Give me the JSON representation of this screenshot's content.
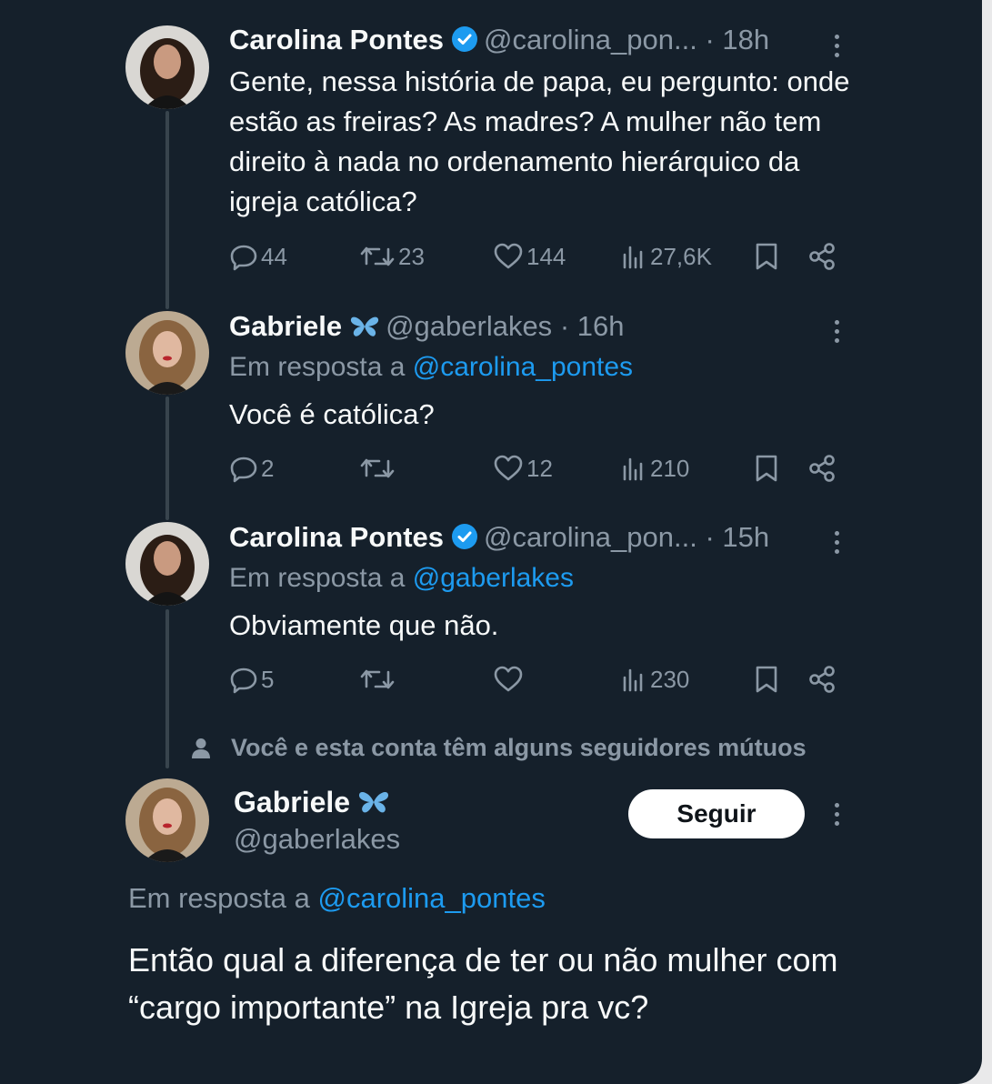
{
  "thread": [
    {
      "name": "Carolina Pontes",
      "verified": true,
      "handle": "@carolina_pon...",
      "time": "· 18h",
      "reply_prefix": "",
      "reply_handle": "",
      "text": "Gente, nessa história de papa, eu pergunto: onde estão as freiras? As madres? A mulher não tem direito à nada no ordenamento hierárquico da igreja católica?",
      "replies": "44",
      "reposts": "23",
      "likes": "144",
      "views": "27,6K"
    },
    {
      "name": "Gabriele",
      "badge": "butterfly",
      "handle": "@gaberlakes",
      "time": "· 16h",
      "reply_prefix": "Em resposta a ",
      "reply_handle": "@carolina_pontes",
      "text": "Você é católica?",
      "replies": "2",
      "reposts": "",
      "likes": "12",
      "views": "210"
    },
    {
      "name": "Carolina Pontes",
      "verified": true,
      "handle": "@carolina_pon...",
      "time": "· 15h",
      "reply_prefix": "Em resposta a ",
      "reply_handle": "@gaberlakes",
      "text": "Obviamente que não.",
      "replies": "5",
      "reposts": "",
      "likes": "",
      "views": "230"
    }
  ],
  "mutual_notice": "Você e esta conta têm alguns seguidores mútuos",
  "main_post": {
    "name": "Gabriele",
    "badge": "butterfly",
    "handle": "@gaberlakes",
    "follow_label": "Seguir",
    "reply_prefix": "Em resposta a ",
    "reply_handle": "@carolina_pontes",
    "text": "Então qual a diferença de ter ou não mulher com “cargo importante” na Igreja pra vc?"
  },
  "colors": {
    "background": "#15202b",
    "text": "#f7f9f9",
    "muted": "#8b98a5",
    "link": "#1d9bf0",
    "verified": "#1d9bf0",
    "butterfly": "#6ab3e8"
  }
}
